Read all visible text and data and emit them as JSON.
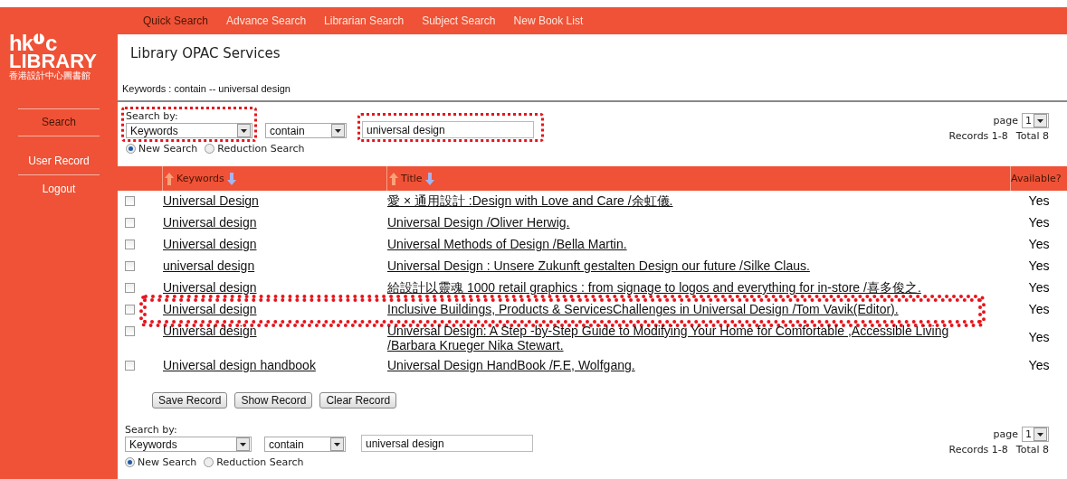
{
  "nav": [
    {
      "label": "Quick Search",
      "selected": true
    },
    {
      "label": "Advance Search",
      "selected": false
    },
    {
      "label": "Librarian Search",
      "selected": false
    },
    {
      "label": "Subject Search",
      "selected": false
    },
    {
      "label": "New Book List",
      "selected": false
    }
  ],
  "logo": {
    "left": "hk",
    "right": "c",
    "name": "LIBRARY",
    "subtitle": "香港設計中心圖書館"
  },
  "sidebar": [
    {
      "label": "Search",
      "selected": true
    },
    {
      "label": "User Record",
      "selected": false
    },
    {
      "label": "Logout",
      "selected": false
    }
  ],
  "page_title": "Library OPAC Services",
  "breadcrumb": "Keywords : contain -- universal design",
  "search_top": {
    "label": "Search by:",
    "field": "Keywords",
    "operator": "contain",
    "query": "universal design",
    "field_highlighted": true,
    "query_highlighted": true,
    "modes": [
      {
        "label": "New Search",
        "selected": true
      },
      {
        "label": "Reduction Search",
        "selected": false
      }
    ]
  },
  "pager_top": {
    "label": "page",
    "page": "1",
    "records": "Records 1-8",
    "total": "Total 8"
  },
  "table": {
    "columns": [
      "Keywords",
      "Title",
      "Available?"
    ],
    "rows": [
      {
        "checked": false,
        "keyword": "Universal Design",
        "title": "愛 × 通用設計 :Design with Love and Care /余虹儀.",
        "available": "Yes",
        "highlighted": false
      },
      {
        "checked": false,
        "keyword": "Universal design",
        "title": "Universal Design /Oliver Herwig.",
        "available": "Yes",
        "highlighted": false
      },
      {
        "checked": false,
        "keyword": "Universal design",
        "title": "Universal Methods of Design /Bella Martin.",
        "available": "Yes",
        "highlighted": false
      },
      {
        "checked": false,
        "keyword": "universal design",
        "title": "Universal Design : Unsere Zukunft gestalten Design our future /Silke Claus.",
        "available": "Yes",
        "highlighted": false
      },
      {
        "checked": false,
        "keyword": "Universal design",
        "title": "給設計以靈魂 1000 retail graphics : from signage to logos and everything for in-store /喜多俊之.",
        "available": "Yes",
        "highlighted": false
      },
      {
        "checked": false,
        "keyword": "Universal design",
        "title": "Inclusive Buildings, Products & ServicesChallenges in Universal Design /Tom Vavik(Editor).",
        "available": "Yes",
        "highlighted": true
      },
      {
        "checked": false,
        "keyword": "Universal design",
        "title": "Universal Design: A Step -by-Step Guide to Modifying Your Home for Comfortable ,Accessible Living /Barbara Krueger Nika Stewart.",
        "available": "Yes",
        "highlighted": false
      },
      {
        "checked": false,
        "keyword": "Universal design handbook",
        "title": "Universal Design HandBook /F.E, Wolfgang.",
        "available": "Yes",
        "highlighted": false
      }
    ]
  },
  "buttons": [
    "Save Record",
    "Show Record",
    "Clear Record"
  ],
  "search_bottom": {
    "label": "Search by:",
    "field": "Keywords",
    "operator": "contain",
    "query": "universal design",
    "field_highlighted": false,
    "query_highlighted": false,
    "modes": [
      {
        "label": "New Search",
        "selected": true
      },
      {
        "label": "Reduction Search",
        "selected": false
      }
    ]
  },
  "pager_bottom": {
    "label": "page",
    "page": "1",
    "records": "Records 1-8",
    "total": "Total 8"
  }
}
